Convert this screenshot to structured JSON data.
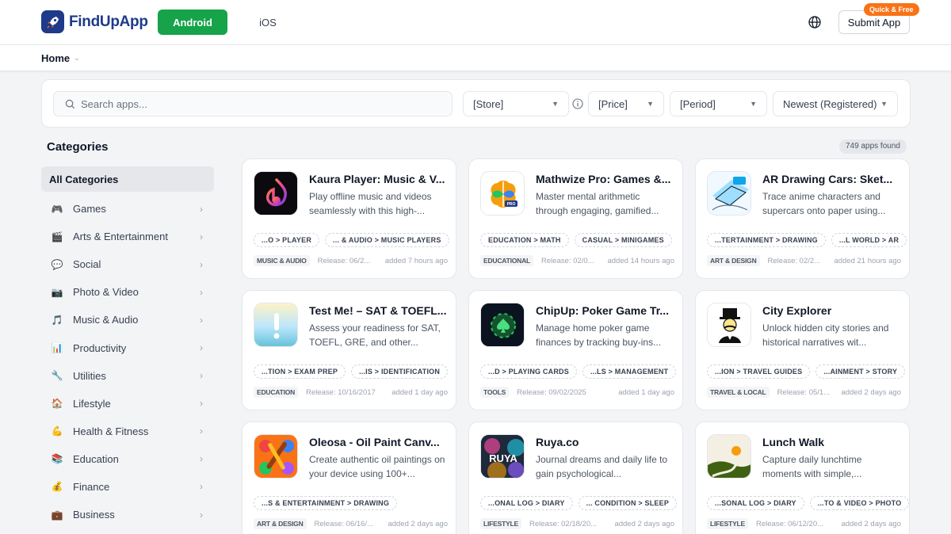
{
  "brand": {
    "name": "FindUpApp"
  },
  "platform_tabs": {
    "android": "Android",
    "ios": "iOS"
  },
  "header": {
    "submit_label": "Submit App",
    "submit_badge": "Quick & Free",
    "globe_icon": "globe-icon"
  },
  "breadcrumb": {
    "home": "Home"
  },
  "filters": {
    "search_placeholder": "Search apps...",
    "store": "[Store]",
    "price": "[Price]",
    "period": "[Period]",
    "sort": "Newest (Registered)"
  },
  "sidebar": {
    "title": "Categories",
    "items": [
      {
        "label": "All Categories",
        "icon": ""
      },
      {
        "label": "Games",
        "icon": "🎮"
      },
      {
        "label": "Arts & Entertainment",
        "icon": "🎬"
      },
      {
        "label": "Social",
        "icon": "💬"
      },
      {
        "label": "Photo & Video",
        "icon": "📷"
      },
      {
        "label": "Music & Audio",
        "icon": "🎵"
      },
      {
        "label": "Productivity",
        "icon": "📊"
      },
      {
        "label": "Utilities",
        "icon": "🔧"
      },
      {
        "label": "Lifestyle",
        "icon": "🏠"
      },
      {
        "label": "Health & Fitness",
        "icon": "💪"
      },
      {
        "label": "Education",
        "icon": "📚"
      },
      {
        "label": "Finance",
        "icon": "💰"
      },
      {
        "label": "Business",
        "icon": "💼"
      }
    ]
  },
  "results": {
    "count_label": "749 apps found"
  },
  "apps": [
    {
      "name": "Kaura Player: Music & V...",
      "desc": "Play offline music and videos seamlessly with this high-...",
      "tags": [
        "...O > PLAYER",
        "... & AUDIO > MUSIC PLAYERS"
      ],
      "category": "MUSIC & AUDIO",
      "release": "Release: 06/2...",
      "added": "added 7 hours ago",
      "icon": "kaura-icon"
    },
    {
      "name": "Mathwize Pro: Games &...",
      "desc": "Master mental arithmetic through engaging, gamified...",
      "tags": [
        "EDUCATION > MATH",
        "CASUAL > MINIGAMES"
      ],
      "category": "EDUCATIONAL",
      "release": "Release: 02/0...",
      "added": "added 14 hours ago",
      "icon": "mathwize-icon"
    },
    {
      "name": "AR Drawing Cars: Sket...",
      "desc": "Trace anime characters and supercars onto paper using...",
      "tags": [
        "...TERTAINMENT > DRAWING",
        "...L WORLD > AR"
      ],
      "category": "ART & DESIGN",
      "release": "Release: 02/2...",
      "added": "added 21 hours ago",
      "icon": "ar-drawing-icon"
    },
    {
      "name": "Test Me! – SAT & TOEFL...",
      "desc": "Assess your readiness for SAT, TOEFL, GRE, and other...",
      "tags": [
        "...TION > EXAM PREP",
        "...IS > IDENTIFICATION"
      ],
      "category": "EDUCATION",
      "release": "Release: 10/16/2017",
      "added": "added 1 day ago",
      "icon": "testme-icon"
    },
    {
      "name": "ChipUp: Poker Game Tr...",
      "desc": "Manage home poker game finances by tracking buy-ins...",
      "tags": [
        "...D > PLAYING CARDS",
        "...LS > MANAGEMENT"
      ],
      "category": "TOOLS",
      "release": "Release: 09/02/2025",
      "added": "added 1 day ago",
      "icon": "chipup-icon"
    },
    {
      "name": "City Explorer",
      "desc": "Unlock hidden city stories and historical narratives wit...",
      "tags": [
        "...ION > TRAVEL GUIDES",
        "...AINMENT > STORY"
      ],
      "category": "TRAVEL & LOCAL",
      "release": "Release: 05/1...",
      "added": "added 2 days ago",
      "icon": "city-explorer-icon"
    },
    {
      "name": "Oleosa - Oil Paint Canv...",
      "desc": "Create authentic oil paintings on your device using 100+...",
      "tags": [
        "...S & ENTERTAINMENT > DRAWING"
      ],
      "category": "ART & DESIGN",
      "release": "Release: 06/16/...",
      "added": "added 2 days ago",
      "icon": "oleosa-icon"
    },
    {
      "name": "Ruya.co",
      "desc": "Journal dreams and daily life to gain psychological...",
      "tags": [
        "...ONAL LOG > DIARY",
        "... CONDITION > SLEEP"
      ],
      "category": "LIFESTYLE",
      "release": "Release: 02/18/20...",
      "added": "added 2 days ago",
      "icon": "ruya-icon"
    },
    {
      "name": "Lunch Walk",
      "desc": "Capture daily lunchtime moments with simple,...",
      "tags": [
        "...SONAL LOG > DIARY",
        "...TO & VIDEO > PHOTO"
      ],
      "category": "LIFESTYLE",
      "release": "Release: 06/12/20...",
      "added": "added 2 days ago",
      "icon": "lunch-walk-icon"
    }
  ],
  "colors": {
    "accent_green": "#16a34a",
    "brand_blue": "#1e3a8a",
    "badge_orange": "#f97316"
  }
}
